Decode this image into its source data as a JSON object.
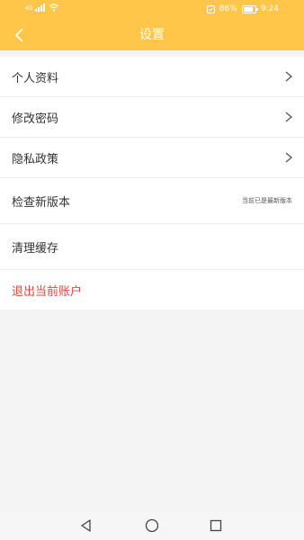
{
  "status_bar": {
    "network": "4G",
    "battery_percent": "86%",
    "battery_level": 0.86,
    "time": "9:24"
  },
  "header": {
    "back_icon": "chevron-left-icon",
    "title": "设置"
  },
  "settings": {
    "profile": "个人资料",
    "change_password": "修改密码",
    "privacy_policy": "隐私政策",
    "check_version": "检查新版本",
    "version_status": "当前已是最新版本",
    "clear_cache": "清理缓存",
    "logout": "退出当前账户"
  },
  "colors": {
    "accent": "#ffc64a",
    "danger": "#e2473b"
  },
  "nav_bar": {
    "icons": [
      "back-triangle-icon",
      "home-circle-icon",
      "recents-square-icon"
    ]
  }
}
